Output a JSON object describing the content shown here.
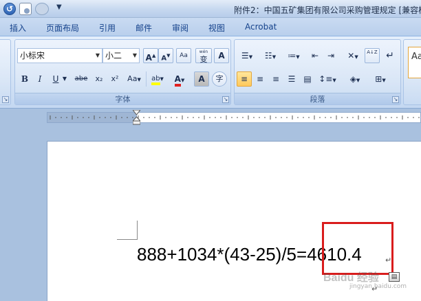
{
  "window": {
    "title": "附件2：中国五矿集团有限公司采购管理规定 [兼容模",
    "qat_undo_icon": "↺",
    "qat_dropdown": "▼"
  },
  "tabs": [
    "插入",
    "页面布局",
    "引用",
    "邮件",
    "审阅",
    "视图",
    "Acrobat"
  ],
  "font_group": {
    "label": "字体",
    "font_name": "小标宋",
    "font_size": "小二",
    "grow_label": "A",
    "shrink_label": "A",
    "clear_format_label": "Aa",
    "phonetic_label": "wén",
    "phonetic_char": "变",
    "char_border_label": "A",
    "bold": "B",
    "italic": "I",
    "underline": "U",
    "strike": "abe",
    "subscript": "x₂",
    "superscript": "x²",
    "change_case": "Aa",
    "highlight": "ab",
    "font_color": "A",
    "char_shading": "A",
    "enclose_char": "字",
    "highlight_color": "#ffff00",
    "font_color_value": "#e02020"
  },
  "paragraph_group": {
    "label": "段落",
    "sort_label": "A↓Z",
    "show_marks": "↵"
  },
  "styles_group": {
    "preview": "Aa"
  },
  "document": {
    "formula": "888+1034*(43-25)/5=4610.4",
    "para_mark": "↵",
    "watermark": "Baidu 经验",
    "watermark_sub": "jingyan.baidu.com",
    "paste_icon": "▤"
  },
  "colors": {
    "highlight_box": "#d91c1c",
    "ribbon_text": "#15428b"
  }
}
